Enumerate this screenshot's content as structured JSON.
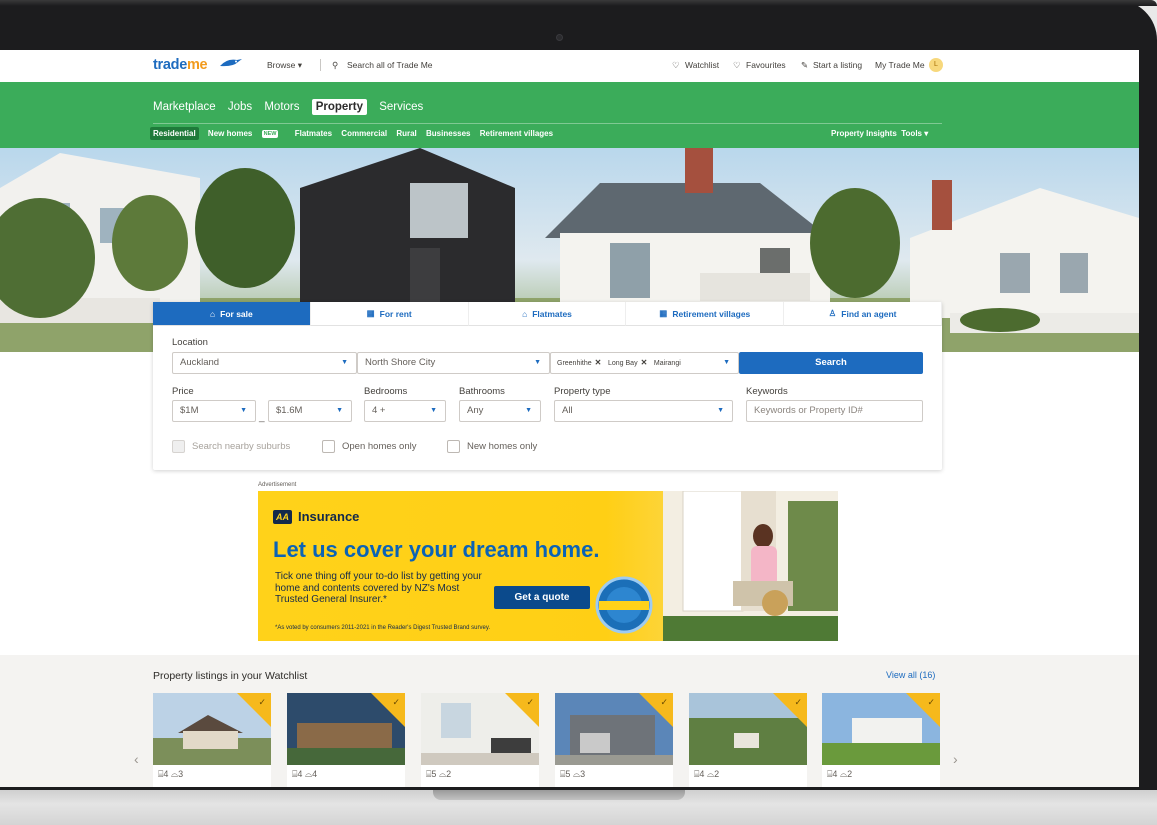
{
  "topbar": {
    "logo_trade": "trade",
    "logo_me": "me",
    "browse": "Browse ▾",
    "search": "Search all of Trade Me",
    "watchlist": "Watchlist",
    "favourites": "Favourites",
    "start_listing": "Start a listing",
    "my_trade_me": "My Trade Me",
    "avatar_initial": "L"
  },
  "mainnav": [
    "Marketplace",
    "Jobs",
    "Motors",
    "Property",
    "Services"
  ],
  "subnav": {
    "residential": "Residential",
    "new_homes": "New homes",
    "new_badge": "NEW",
    "flatmates": "Flatmates",
    "commercial": "Commercial",
    "rural": "Rural",
    "businesses": "Businesses",
    "retirement": "Retirement villages",
    "insights": "Property Insights",
    "tools": "Tools ▾"
  },
  "tabs": [
    "For sale",
    "For rent",
    "Flatmates",
    "Retirement villages",
    "Find an agent"
  ],
  "search_form": {
    "location_label": "Location",
    "region": "Auckland",
    "district": "North Shore City",
    "suburbs": [
      "Greenhithe",
      "Long Bay",
      "Mairangi"
    ],
    "search_button": "Search",
    "price_label": "Price",
    "price_min": "$1M",
    "dash": "_",
    "price_max": "$1.6M",
    "bedrooms_label": "Bedrooms",
    "bedrooms": "4 +",
    "bathrooms_label": "Bathrooms",
    "bathrooms": "Any",
    "type_label": "Property type",
    "type": "All",
    "keywords_label": "Keywords",
    "keywords_placeholder": "Keywords or Property ID#",
    "nearby": "Search nearby suburbs",
    "open_homes": "Open homes only",
    "new_homes": "New homes only"
  },
  "ad": {
    "label": "Advertisement",
    "brand_mark": "AA",
    "brand": "Insurance",
    "headline": "Let us cover your dream home.",
    "body": "Tick one thing off your to-do list by getting your home and contents covered by NZ's Most Trusted General Insurer.*",
    "cta": "Get a quote",
    "fine_print": "*As voted by consumers 2011-2021 in the Reader's Digest Trusted Brand survey."
  },
  "watchlist": {
    "title": "Property listings in your Watchlist",
    "view_all": "View all (16)",
    "cards": [
      {
        "beds": "4",
        "baths": "3"
      },
      {
        "beds": "4",
        "baths": "4"
      },
      {
        "beds": "5",
        "baths": "2"
      },
      {
        "beds": "5",
        "baths": "3"
      },
      {
        "beds": "4",
        "baths": "2"
      },
      {
        "beds": "4",
        "baths": "2"
      }
    ]
  },
  "colors": {
    "brand_blue": "#1d6bbf",
    "nav_green": "#3bac5a",
    "watchlist_corner": "#f6b91c",
    "ad_yellow": "#ffd21a"
  }
}
